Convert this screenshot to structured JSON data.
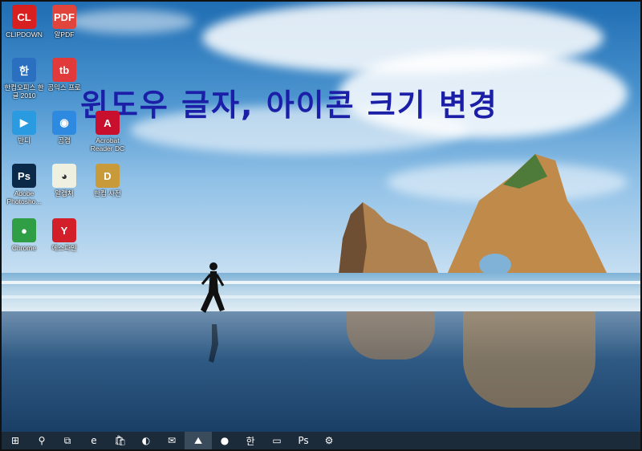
{
  "heading": "윈도우 글자, 아이콘 크기 변경",
  "desktop_icons": [
    {
      "label": "CLIPDOWN",
      "icon": "clipdown-icon",
      "color": "#d92020",
      "glyph": "CL"
    },
    {
      "label": "알PDF",
      "icon": "alpdf-icon",
      "color": "#e0443a",
      "glyph": "PDF"
    },
    {
      "label": "한컴오피스 한글 2010",
      "icon": "hancom-office-icon",
      "color": "#2a6fc0",
      "glyph": "한"
    },
    {
      "label": "곰믹스 프로",
      "icon": "gommix-pro-icon",
      "color": "#e23a3a",
      "glyph": "tb"
    },
    {
      "label": "반디",
      "icon": "bandi-icon",
      "color": "#2a9be0",
      "glyph": "▶"
    },
    {
      "label": "곰캠",
      "icon": "gomcam-icon",
      "color": "#2e8ae0",
      "glyph": "◉"
    },
    {
      "label": "Acrobat Reader DC",
      "icon": "acrobat-reader-icon",
      "color": "#c8102e",
      "glyph": "A"
    },
    {
      "label": "Adobe Photosho...",
      "icon": "photoshop-icon",
      "color": "#0b2a4a",
      "glyph": "Ps"
    },
    {
      "label": "알캡처",
      "icon": "alcapture-icon",
      "color": "#f0f0e0",
      "glyph": "◕"
    },
    {
      "label": "한컴 사전",
      "icon": "hancom-dictionary-icon",
      "color": "#c89a3a",
      "glyph": "D"
    },
    {
      "label": "Chrome",
      "icon": "chrome-icon",
      "color": "#2f9e44",
      "glyph": "●"
    },
    {
      "label": "에스파인",
      "icon": "yes-icon",
      "color": "#d31f2a",
      "glyph": "Y"
    }
  ],
  "taskbar": {
    "items": [
      {
        "name": "start-button",
        "glyph": "⊞"
      },
      {
        "name": "search-button",
        "glyph": "⚲"
      },
      {
        "name": "task-view-button",
        "glyph": "⧉"
      },
      {
        "name": "internet-explorer-icon",
        "glyph": "e"
      },
      {
        "name": "store-icon",
        "glyph": "🛍"
      },
      {
        "name": "edge-icon",
        "glyph": "◐"
      },
      {
        "name": "mail-icon",
        "glyph": "✉"
      },
      {
        "name": "photos-icon",
        "glyph": "⛰"
      },
      {
        "name": "chrome-icon",
        "glyph": "●"
      },
      {
        "name": "hancom-taskbar-icon",
        "glyph": "한"
      },
      {
        "name": "file-explorer-icon",
        "glyph": "▭"
      },
      {
        "name": "photoshop-taskbar-icon",
        "glyph": "Ps"
      },
      {
        "name": "settings-icon",
        "glyph": "⚙"
      }
    ],
    "active_index": 7
  }
}
